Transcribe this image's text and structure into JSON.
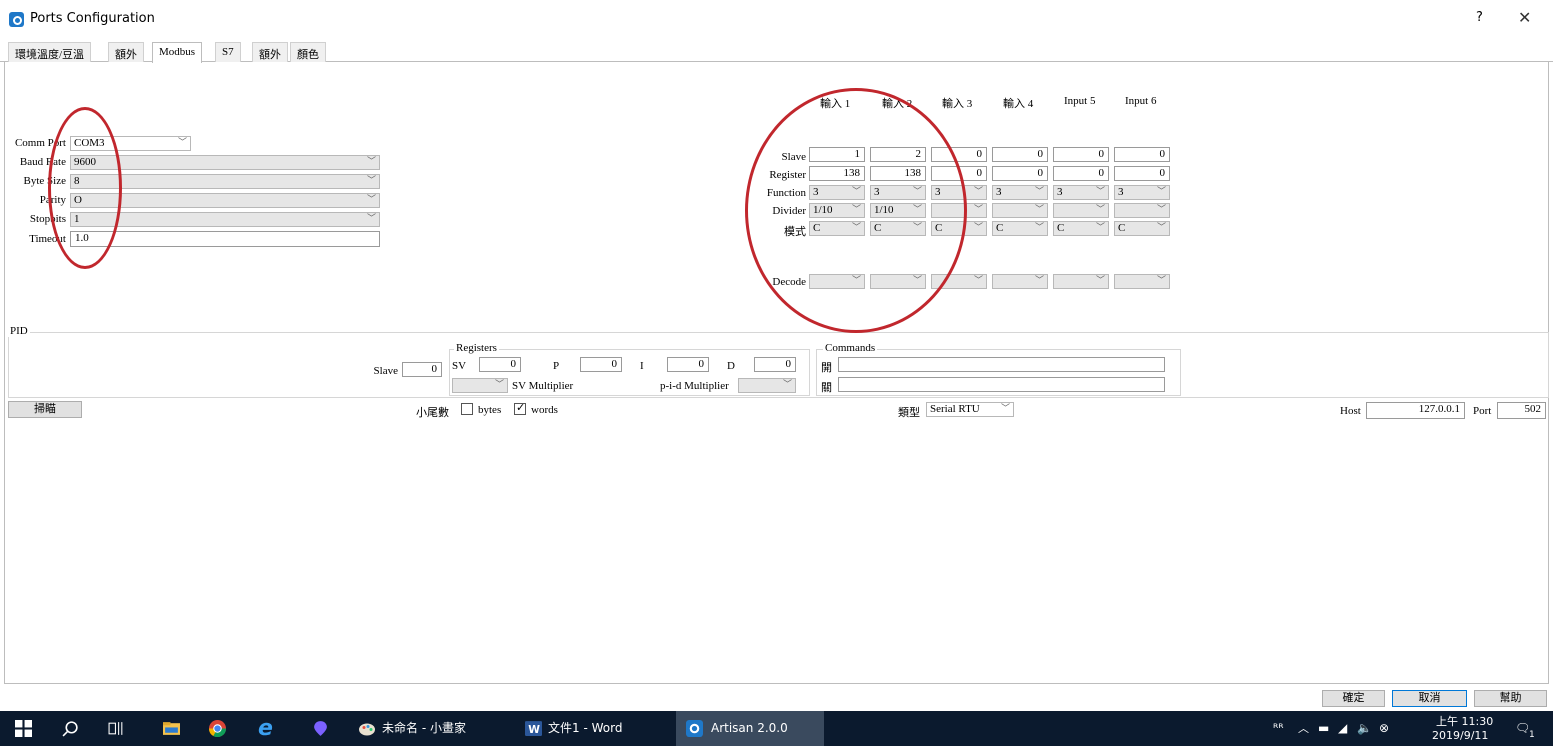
{
  "window": {
    "title": "Ports Configuration",
    "help": "?",
    "close": "✕"
  },
  "tabs": [
    "環境溫度/豆溫",
    "額外",
    "Modbus",
    "S7",
    "額外",
    "顏色"
  ],
  "active_tab": "Modbus",
  "serial": {
    "comm_port_label": "Comm Port",
    "comm_port_value": "COM3",
    "baud_label": "Baud Rate",
    "baud_value": "9600",
    "bytesize_label": "Byte Size",
    "bytesize_value": "8",
    "parity_label": "Parity",
    "parity_value": "O",
    "stopbits_label": "Stopbits",
    "stopbits_value": "1",
    "timeout_label": "Timeout",
    "timeout_value": "1.0"
  },
  "inputs": {
    "headers": [
      "輸入 1",
      "輸入 2",
      "輸入 3",
      "輸入 4",
      "Input 5",
      "Input 6"
    ],
    "row_labels": {
      "slave": "Slave",
      "register": "Register",
      "function": "Function",
      "divider": "Divider",
      "mode": "模式",
      "decode": "Decode"
    },
    "slave": [
      "1",
      "2",
      "0",
      "0",
      "0",
      "0"
    ],
    "register": [
      "138",
      "138",
      "0",
      "0",
      "0",
      "0"
    ],
    "function": [
      "3",
      "3",
      "3",
      "3",
      "3",
      "3"
    ],
    "divider": [
      "1/10",
      "1/10",
      "",
      "",
      "",
      ""
    ],
    "mode": [
      "C",
      "C",
      "C",
      "C",
      "C",
      "C"
    ],
    "decode": [
      "",
      "",
      "",
      "",
      "",
      ""
    ]
  },
  "pid": {
    "title": "PID",
    "slave_label": "Slave",
    "slave_value": "0",
    "registers_title": "Registers",
    "sv_label": "SV",
    "sv_value": "0",
    "p_label": "P",
    "p_value": "0",
    "i_label": "I",
    "i_value": "0",
    "d_label": "D",
    "d_value": "0",
    "sv_multiplier_label": "SV Multiplier",
    "pid_multiplier_label": "p-i-d Multiplier",
    "commands_title": "Commands",
    "on_label": "開",
    "on_value": "",
    "off_label": "關",
    "off_value": ""
  },
  "bottom": {
    "scan_button": "掃瞄",
    "decimal_label": "小尾數",
    "bytes_label": "bytes",
    "bytes_checked": false,
    "words_label": "words",
    "words_checked": true,
    "type_label": "類型",
    "type_value": "Serial RTU",
    "host_label": "Host",
    "host_value": "127.0.0.1",
    "port_label": "Port",
    "port_value": "502"
  },
  "dialog_buttons": {
    "ok": "確定",
    "cancel": "取消",
    "help": "幫助"
  },
  "taskbar": {
    "items": [
      "未命名 - 小畫家",
      "文件1 - Word",
      "Artisan 2.0.0"
    ],
    "clock_time": "上午 11:30",
    "clock_date": "2019/9/11",
    "notification_count": "1"
  },
  "colors": {
    "annotation": "#c1272d",
    "taskbar": "#0b1a2e",
    "accent": "#0078d7"
  }
}
